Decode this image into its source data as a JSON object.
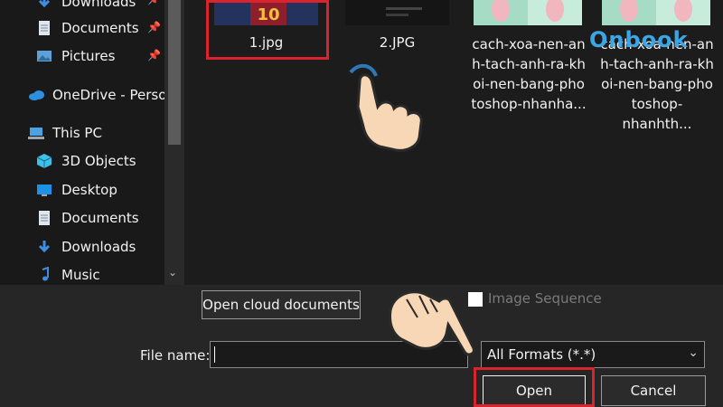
{
  "sidebar": {
    "quick_access": [
      {
        "label": "Downloads",
        "icon": "download-arrow-icon",
        "pinned": true
      },
      {
        "label": "Documents",
        "icon": "document-icon",
        "pinned": true
      },
      {
        "label": "Pictures",
        "icon": "pictures-icon",
        "pinned": true
      }
    ],
    "onedrive": {
      "label": "OneDrive - Person",
      "icon": "cloud-icon"
    },
    "this_pc": {
      "label": "This PC",
      "icon": "computer-icon"
    },
    "pc_items": [
      {
        "label": "3D Objects",
        "icon": "cube-icon"
      },
      {
        "label": "Desktop",
        "icon": "desktop-icon"
      },
      {
        "label": "Documents",
        "icon": "document-icon"
      },
      {
        "label": "Downloads",
        "icon": "download-arrow-icon"
      },
      {
        "label": "Music",
        "icon": "music-note-icon"
      }
    ]
  },
  "files": [
    {
      "name": "1.jpg",
      "selected_highlight": true
    },
    {
      "name": "2.JPG"
    },
    {
      "name_lines": [
        "cach-xoa-nen-an",
        "h-tach-anh-ra-kh",
        "oi-nen-bang-pho",
        "toshop-nhanha..."
      ]
    },
    {
      "name_lines": [
        "cach-xoa-nen-an",
        "h-tach-anh-ra-kh",
        "oi-nen-bang-pho",
        "toshop-nhanhth..."
      ]
    }
  ],
  "watermark": {
    "text": "Onbook"
  },
  "bottom": {
    "open_cloud_label": "Open cloud documents",
    "image_sequence_label": "Image Sequence",
    "file_name_label": "File name:",
    "file_name_value": "",
    "format_value": "All Formats (*.*)",
    "open_label": "Open",
    "cancel_label": "Cancel"
  },
  "colors": {
    "highlight": "#d9232d",
    "brand_watermark": "#3aa6e6"
  }
}
